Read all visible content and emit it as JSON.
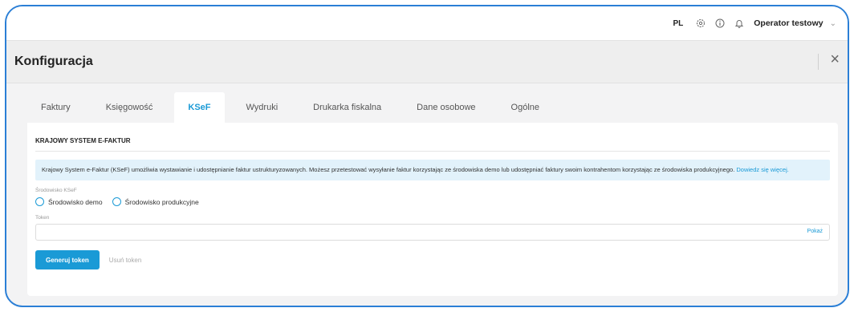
{
  "topbar": {
    "lang": "PL",
    "icons": [
      "gear-icon",
      "info-icon",
      "bell-icon"
    ],
    "operator": "Operator testowy"
  },
  "header": {
    "title": "Konfiguracja"
  },
  "tabs": [
    {
      "label": "Faktury"
    },
    {
      "label": "Księgowość"
    },
    {
      "label": "KSeF",
      "active": true
    },
    {
      "label": "Wydruki"
    },
    {
      "label": "Drukarka fiskalna"
    },
    {
      "label": "Dane osobowe"
    },
    {
      "label": "Ogólne"
    }
  ],
  "ksef": {
    "section_title": "KRAJOWY SYSTEM E-FAKTUR",
    "info_text": "Krajowy System e-Faktur (KSeF) umożliwia wystawianie i udostępnianie faktur ustrukturyzowanych. Możesz przetestować wysyłanie faktur korzystając ze środowiska demo lub udostępniać faktury swoim kontrahentom korzystając ze środowiska produkcyjnego.",
    "info_link": "Dowiedz się więcej.",
    "env_label": "Środowisko KSeF",
    "env_options": [
      "Środowisko demo",
      "Środowisko produkcyjne"
    ],
    "token_label": "Token",
    "token_value": "",
    "show_label": "Pokaż",
    "generate_label": "Generuj token",
    "delete_label": "Usuń token"
  },
  "colors": {
    "accent": "#1a9ad6",
    "frame": "#2b7fd6",
    "info_bg": "#e2f2fb"
  }
}
